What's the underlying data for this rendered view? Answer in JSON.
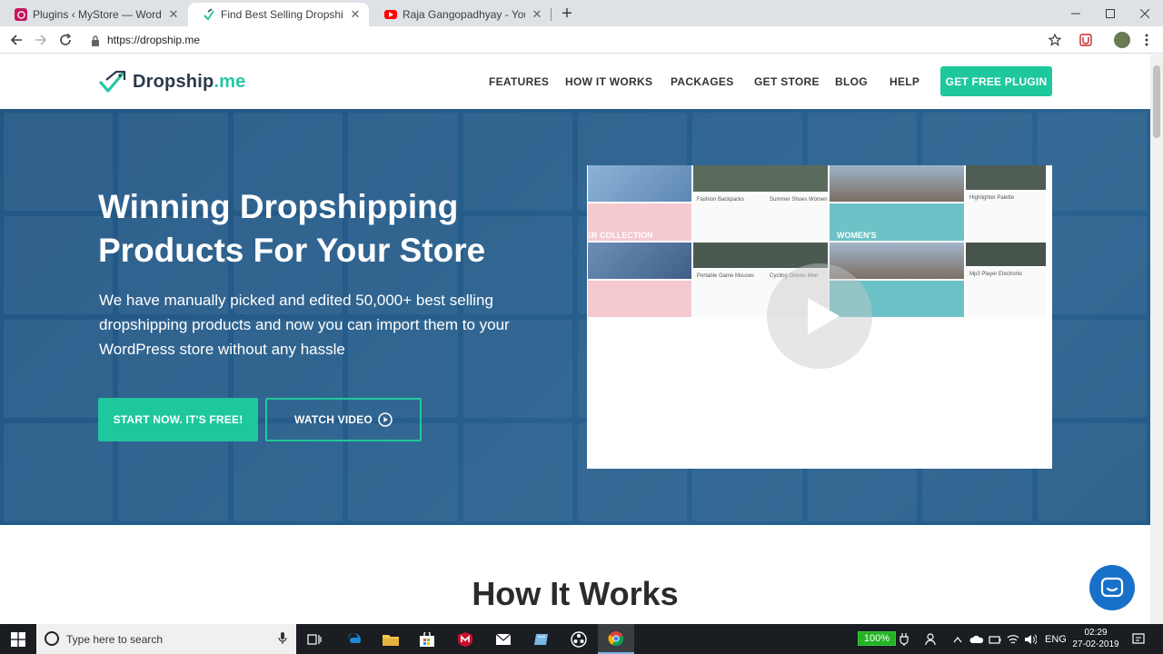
{
  "browser": {
    "tabs": [
      {
        "title": "Plugins ‹ MyStore — WordPress",
        "favicon": "wordpress-icon",
        "active": false
      },
      {
        "title": "Find Best Selling Dropshipping P",
        "favicon": "dropship-logo-icon",
        "active": true
      },
      {
        "title": "Raja Gangopadhyay - YouTube",
        "favicon": "youtube-icon",
        "active": false
      }
    ],
    "close_glyph": "✕",
    "new_tab_glyph": "+",
    "url": "https://dropship.me"
  },
  "site": {
    "logo_main": "Dropship",
    "logo_accent": ".me",
    "nav": [
      "FEATURES",
      "HOW IT WORKS",
      "PACKAGES",
      "GET STORE",
      "BLOG",
      "HELP"
    ],
    "cta": "GET FREE PLUGIN",
    "colors": {
      "accent": "#1fc79c",
      "hero_bg": "#2f6c96",
      "chat": "#1870c8"
    }
  },
  "hero": {
    "title": "Winning Dropshipping Products For Your Store",
    "subtitle": "We have manually picked and edited 50,000+ best selling dropshipping products and now you can import them to your WordPress store without any hassle",
    "start_button": "START NOW. IT'S FREE!",
    "video_button": "WATCH VIDEO"
  },
  "video_thumb": {
    "labels": [
      "Fashion Backpacks",
      "Summer Shoes Women",
      "Highlighter Palette",
      "Portable Game Mouses",
      "Cycling Gloves Men",
      "Mp3 Player Electronic"
    ],
    "banner_women": "WOMEN'S COLLECTION",
    "banner_partial": "ER COLLECTION"
  },
  "section": {
    "title": "How It Works"
  },
  "taskbar": {
    "search_placeholder": "Type here to search",
    "battery": "100%",
    "lang": "ENG",
    "time": "02:29",
    "date": "27-02-2019"
  }
}
